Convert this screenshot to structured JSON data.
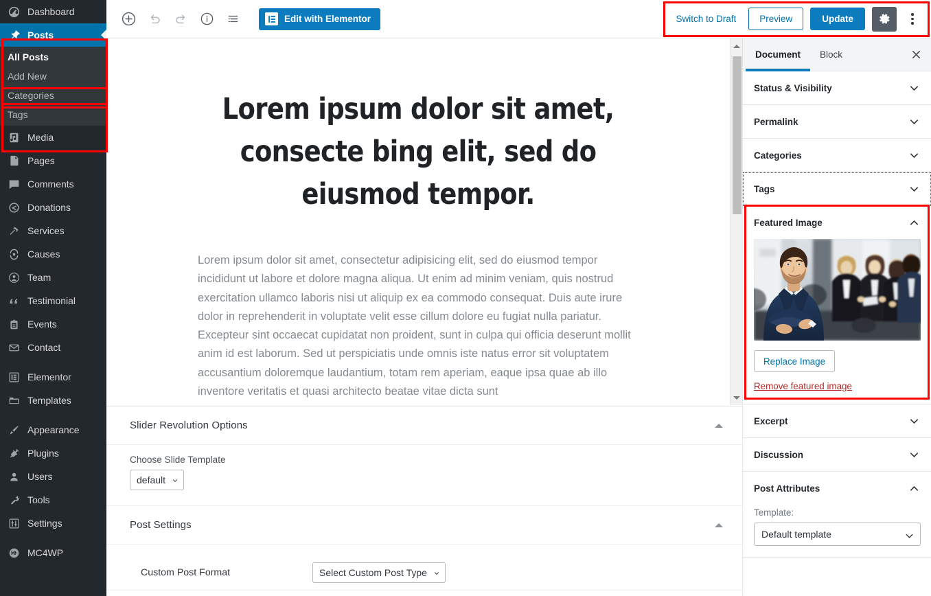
{
  "colors": {
    "wp_blue": "#0c7cbe",
    "admin_dark": "#23282d",
    "submenu_bg": "#32373c",
    "annotation_red": "#ff0000",
    "link_blue": "#0073aa",
    "danger_red": "#b52727"
  },
  "admin_menu": {
    "items": [
      {
        "label": "Dashboard",
        "icon": "dashboard-icon",
        "current": false
      },
      {
        "label": "Posts",
        "icon": "pin-icon",
        "current": true
      },
      {
        "label": "Media",
        "icon": "media-icon",
        "current": false
      },
      {
        "label": "Pages",
        "icon": "pages-icon",
        "current": false
      },
      {
        "label": "Comments",
        "icon": "comment-icon",
        "current": false
      },
      {
        "label": "Donations",
        "icon": "donations-icon",
        "current": false
      },
      {
        "label": "Services",
        "icon": "hammer-icon",
        "current": false
      },
      {
        "label": "Causes",
        "icon": "causes-icon",
        "current": false
      },
      {
        "label": "Team",
        "icon": "user-circle-icon",
        "current": false
      },
      {
        "label": "Testimonial",
        "icon": "quote-icon",
        "current": false
      },
      {
        "label": "Events",
        "icon": "events-icon",
        "current": false
      },
      {
        "label": "Contact",
        "icon": "envelope-icon",
        "current": false
      },
      {
        "label": "Elementor",
        "icon": "elementor-icon",
        "current": false
      },
      {
        "label": "Templates",
        "icon": "folder-icon",
        "current": false
      },
      {
        "label": "Appearance",
        "icon": "brush-icon",
        "current": false
      },
      {
        "label": "Plugins",
        "icon": "plug-icon",
        "current": false
      },
      {
        "label": "Users",
        "icon": "users-icon",
        "current": false
      },
      {
        "label": "Tools",
        "icon": "wrench-icon",
        "current": false
      },
      {
        "label": "Settings",
        "icon": "sliders-icon",
        "current": false
      },
      {
        "label": "MC4WP",
        "icon": "mc4wp-icon",
        "current": false
      }
    ],
    "posts_submenu": [
      {
        "label": "All Posts",
        "current": true
      },
      {
        "label": "Add New",
        "current": false
      },
      {
        "label": "Categories",
        "current": false
      },
      {
        "label": "Tags",
        "current": false
      }
    ]
  },
  "toolbar": {
    "add_block_icon": "plus-circle-icon",
    "undo_icon": "undo-icon",
    "redo_icon": "redo-icon",
    "info_icon": "info-circle-icon",
    "block_nav_icon": "list-view-icon",
    "elementor_label": "Edit with Elementor",
    "switch_to_draft_label": "Switch to Draft",
    "preview_label": "Preview",
    "update_label": "Update",
    "settings_gear_icon": "gear-icon",
    "more_menu_icon": "kebab-menu-icon"
  },
  "editor": {
    "title": "Lorem ipsum dolor sit amet, consecte bing elit, sed do eiusmod tempor.",
    "body": "Lorem ipsum dolor sit amet, consectetur adipisicing elit, sed do eiusmod tempor incididunt ut labore et dolore magna aliqua. Ut enim ad minim veniam, quis nostrud exercitation ullamco laboris nisi ut aliquip ex ea commodo consequat. Duis aute irure dolor in reprehenderit in voluptate velit esse cillum dolore eu fugiat nulla pariatur. Excepteur sint occaecat cupidatat non proident, sunt in culpa qui officia deserunt mollit anim id est laborum. Sed ut perspiciatis unde omnis iste natus error sit voluptatem accusantium doloremque laudantium, totam rem aperiam, eaque ipsa quae ab illo inventore veritatis et quasi architecto beatae vitae dicta sunt"
  },
  "metaboxes": [
    {
      "title": "Slider Revolution Options",
      "field_label": "Choose Slide Template",
      "field_value": "default"
    },
    {
      "title": "Post Settings",
      "row_label": "Custom Post Format",
      "row_value": "Select Custom Post Type"
    }
  ],
  "settings_sidebar": {
    "tabs": [
      {
        "label": "Document",
        "active": true
      },
      {
        "label": "Block",
        "active": false
      }
    ],
    "close_icon": "close-icon",
    "panels": [
      {
        "label": "Status & Visibility",
        "open": false,
        "focused": false
      },
      {
        "label": "Permalink",
        "open": false,
        "focused": false
      },
      {
        "label": "Categories",
        "open": false,
        "focused": false
      },
      {
        "label": "Tags",
        "open": false,
        "focused": true
      },
      {
        "label": "Featured Image",
        "open": true,
        "focused": false
      },
      {
        "label": "Excerpt",
        "open": false,
        "focused": false
      },
      {
        "label": "Discussion",
        "open": false,
        "focused": false
      },
      {
        "label": "Post Attributes",
        "open": true,
        "focused": false
      }
    ],
    "featured_image": {
      "alt": "Businessman with arms crossed in front of colleagues",
      "replace_label": "Replace Image",
      "remove_label": "Remove featured image"
    },
    "post_attributes": {
      "template_label": "Template:",
      "template_value": "Default template"
    }
  }
}
